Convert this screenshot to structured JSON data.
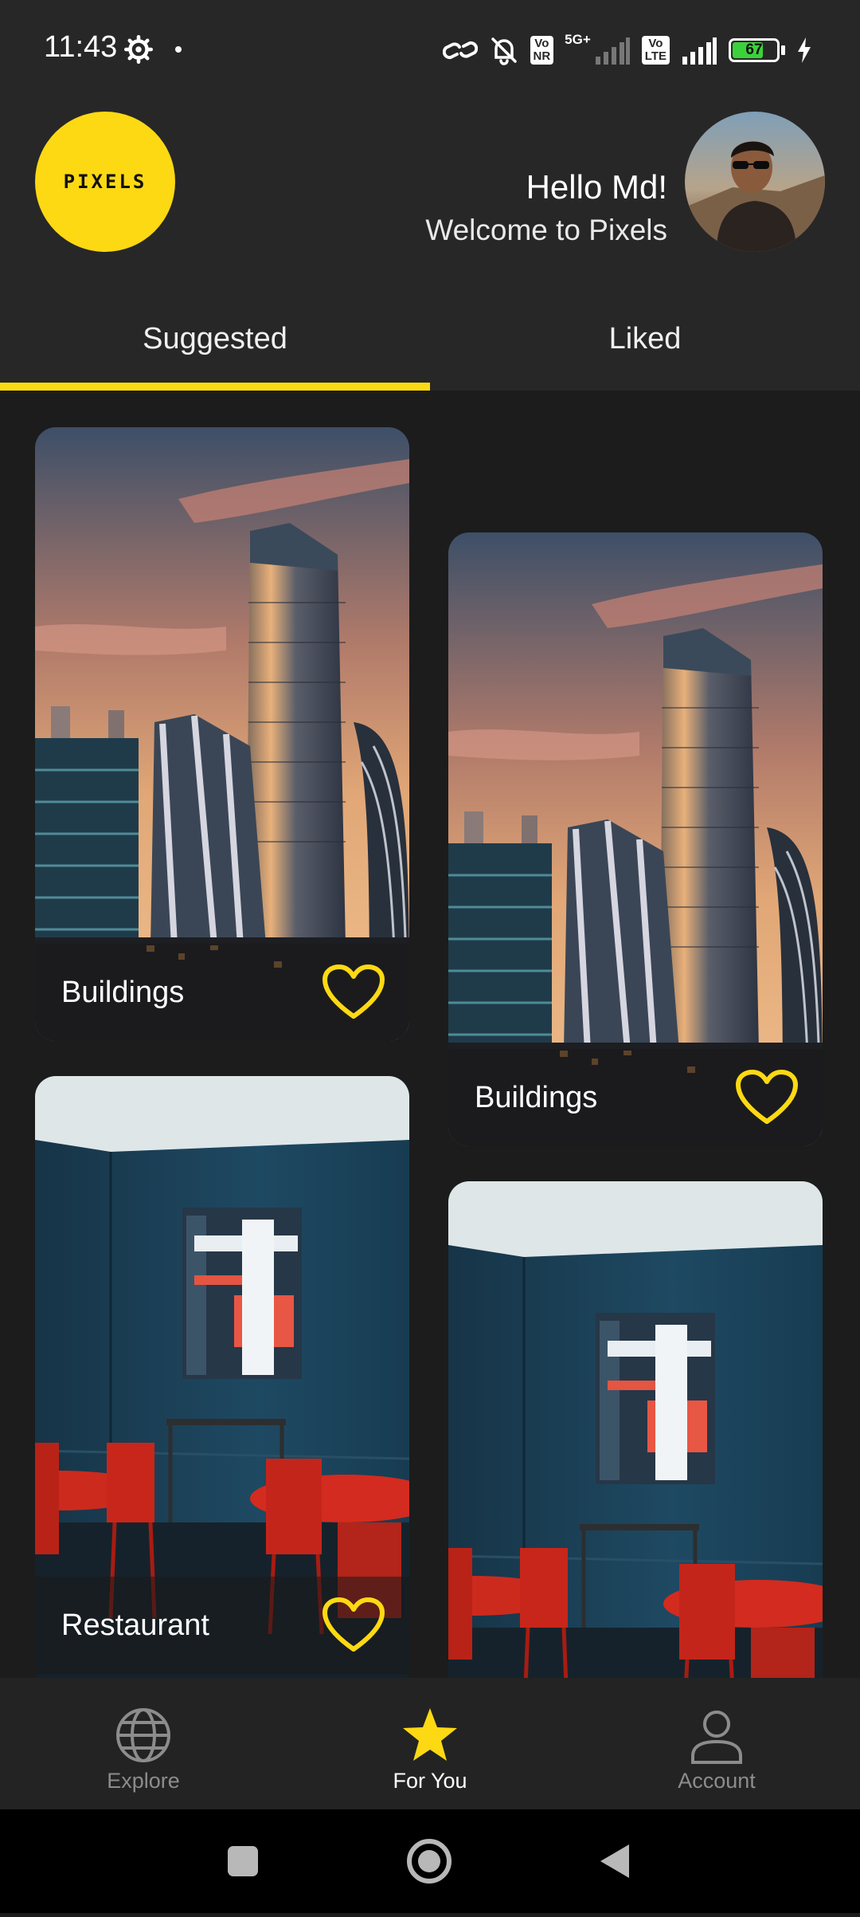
{
  "status_bar": {
    "time": "11:43",
    "badge_vonr": "Vo\nNR",
    "badge_5g": "5G+",
    "badge_volte": "Vo\nLTE",
    "battery_level": "67"
  },
  "header": {
    "logo_text": "PIXELS",
    "greeting": "Hello Md!",
    "welcome": "Welcome to Pixels"
  },
  "tabs": [
    {
      "label": "Suggested",
      "active": true
    },
    {
      "label": "Liked",
      "active": false
    }
  ],
  "cards": [
    {
      "label": "Buildings",
      "liked": false
    },
    {
      "label": "Buildings",
      "liked": false
    },
    {
      "label": "Restaurant",
      "liked": false
    },
    {
      "label": "",
      "liked": false
    }
  ],
  "bottom_nav": [
    {
      "label": "Explore",
      "icon": "globe-icon",
      "active": false
    },
    {
      "label": "For You",
      "icon": "star-icon",
      "active": true
    },
    {
      "label": "Account",
      "icon": "person-icon",
      "active": false
    }
  ],
  "colors": {
    "accent": "#fdd913",
    "surface": "#272727",
    "background": "#1c1c1c",
    "inactive_nav": "#8c8c8c"
  }
}
